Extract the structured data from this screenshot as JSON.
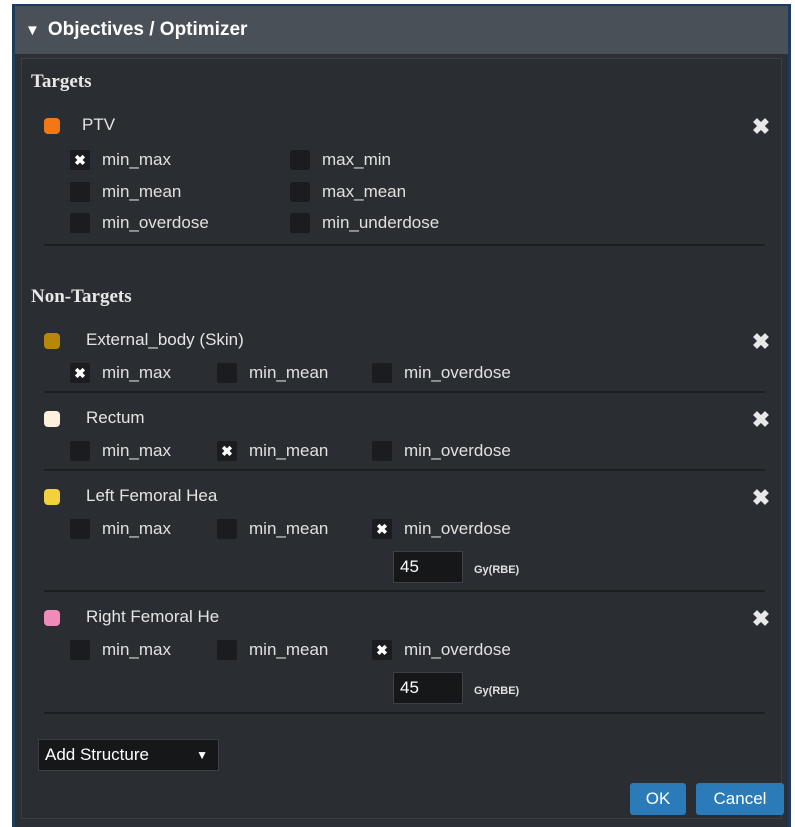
{
  "panel": {
    "title": "Objectives / Optimizer",
    "collapse_glyph": "▼"
  },
  "colors": {
    "header_bg": "#4a5058",
    "panel_bg": "#2a2e33",
    "accent_button": "#2b7bb9"
  },
  "targets": {
    "heading": "Targets",
    "structures": [
      {
        "name": "PTV",
        "color": "#f07817",
        "options": [
          {
            "label": "min_max",
            "checked": true
          },
          {
            "label": "max_min",
            "checked": false
          },
          {
            "label": "min_mean",
            "checked": false
          },
          {
            "label": "max_mean",
            "checked": false
          },
          {
            "label": "min_overdose",
            "checked": false
          },
          {
            "label": "min_underdose",
            "checked": false
          }
        ]
      }
    ]
  },
  "non_targets": {
    "heading": "Non-Targets",
    "structures": [
      {
        "name": "External_body (Skin)",
        "color": "#b8860b",
        "options": [
          {
            "label": "min_max",
            "checked": true
          },
          {
            "label": "min_mean",
            "checked": false
          },
          {
            "label": "min_overdose",
            "checked": false
          }
        ]
      },
      {
        "name": "Rectum",
        "color": "#fdf0dc",
        "options": [
          {
            "label": "min_max",
            "checked": false
          },
          {
            "label": "min_mean",
            "checked": true
          },
          {
            "label": "min_overdose",
            "checked": false
          }
        ]
      },
      {
        "name": "Left Femoral Hea",
        "color": "#f2d13d",
        "options": [
          {
            "label": "min_max",
            "checked": false
          },
          {
            "label": "min_mean",
            "checked": false
          },
          {
            "label": "min_overdose",
            "checked": true
          }
        ],
        "dose_value": "45",
        "dose_unit": "Gy(RBE)"
      },
      {
        "name": "Right Femoral He",
        "color": "#f08ab8",
        "options": [
          {
            "label": "min_max",
            "checked": false
          },
          {
            "label": "min_mean",
            "checked": false
          },
          {
            "label": "min_overdose",
            "checked": true
          }
        ],
        "dose_value": "45",
        "dose_unit": "Gy(RBE)"
      }
    ]
  },
  "add_structure": {
    "selected": "Add Structure",
    "arrow": "▼"
  },
  "buttons": {
    "ok_label": "OK",
    "cancel_label": "Cancel"
  },
  "icons": {
    "remove": "close-icon",
    "checkmark": "✖"
  }
}
